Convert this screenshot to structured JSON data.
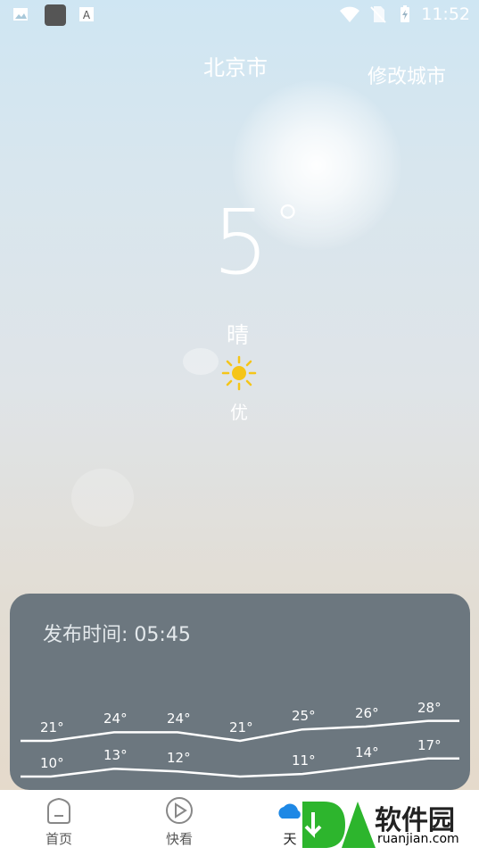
{
  "status_bar": {
    "time": "11:52"
  },
  "header": {
    "city": "北京市",
    "edit_city": "修改城市"
  },
  "current": {
    "temperature": "5",
    "degree_symbol": "°",
    "condition": "晴",
    "air_quality": "优"
  },
  "forecast": {
    "published_label": "发布时间:",
    "published_time": "05:45",
    "highs": [
      "21°",
      "24°",
      "24°",
      "21°",
      "25°",
      "26°",
      "28°"
    ],
    "lows": [
      "10°",
      "13°",
      "12°",
      "",
      "11°",
      "14°",
      "17°"
    ]
  },
  "nav": {
    "items": [
      {
        "label": "首页"
      },
      {
        "label": "快看"
      },
      {
        "label": "天"
      }
    ]
  },
  "watermark": {
    "brand": "软件园",
    "url": "ruanjian.com"
  },
  "colors": {
    "panel": "#6c777f",
    "sun": "#f5c518",
    "watermark_green": "#2db52d"
  }
}
